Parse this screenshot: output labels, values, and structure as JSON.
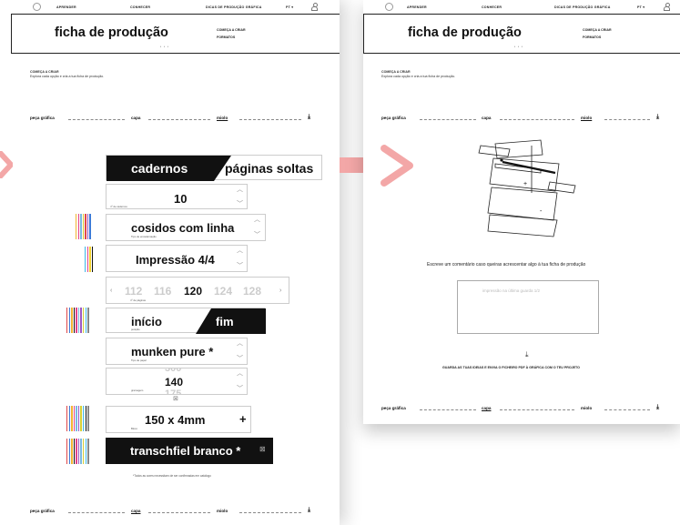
{
  "nav": {
    "items": [
      "APRENDER",
      "CONHECER",
      "DICAS DE PRODUÇÃO GRÁFICA"
    ],
    "lang": "PT"
  },
  "header": {
    "title": "ficha de produção",
    "menu": [
      "COMEÇA A CRIAR",
      "FORMATOS"
    ]
  },
  "intro": {
    "title": "COMEÇA A CRIAR",
    "text": "Explora cada opção e cria a tua ficha de produção."
  },
  "tabs": [
    "peça gráfica",
    "capa",
    "miolo"
  ],
  "binding_toggle": {
    "left": "cadernos",
    "right": "páginas soltas"
  },
  "cadernos": {
    "value": "10",
    "caption": "nº de cadernos"
  },
  "binding": {
    "value": "cosidos com linha",
    "caption": "Tipo de encadernação"
  },
  "print": {
    "value": "Impressão 4/4"
  },
  "pages": {
    "options": [
      "112",
      "116",
      "120",
      "124",
      "128"
    ],
    "selected": "120",
    "caption": "nº de páginas"
  },
  "position_toggle": {
    "left": "início",
    "right": "fim",
    "caption": "posição"
  },
  "paper": {
    "value": "munken pure *",
    "caption": "Tipo de papel"
  },
  "grammage": {
    "prev": "300",
    "value": "140",
    "next": "175",
    "caption": "gramagem"
  },
  "format": {
    "value": "150 x 4mm",
    "caption": "Bloco"
  },
  "endpaper": {
    "value": "transchfiel branco *"
  },
  "footnote": "*Todos as cores necessitam de ser confirmadas em catálogo",
  "comment": {
    "prompt": "Escreve um comentário caso queiras acrescentar algo à tua ficha de produção",
    "placeholder": "impressão na última guarda 1/2"
  },
  "save": {
    "label": "GUARDA AS TUAS IDEIAS E ENVIA O FICHEIRO PDF À GRÁFICA COM O TEU PROJETO"
  },
  "colors": {
    "accent": "#f3a7a7",
    "dark": "#111111"
  }
}
